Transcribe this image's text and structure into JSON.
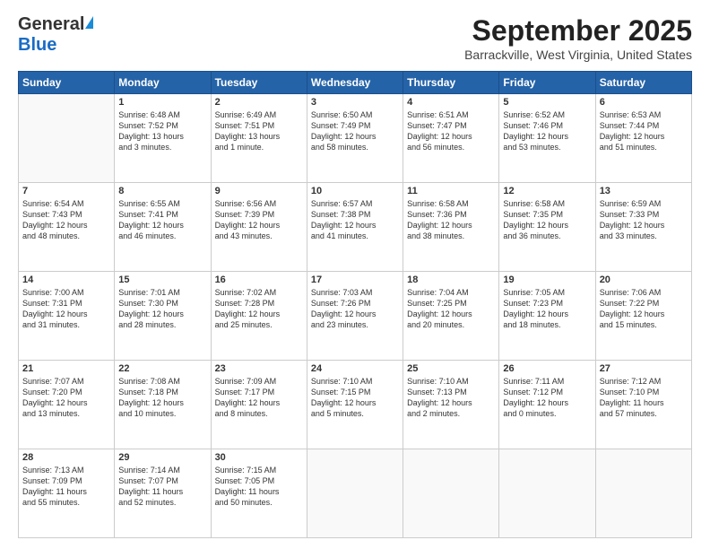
{
  "header": {
    "logo_general": "General",
    "logo_blue": "Blue",
    "month_title": "September 2025",
    "location": "Barrackville, West Virginia, United States"
  },
  "weekdays": [
    "Sunday",
    "Monday",
    "Tuesday",
    "Wednesday",
    "Thursday",
    "Friday",
    "Saturday"
  ],
  "weeks": [
    [
      {
        "day": "",
        "info": ""
      },
      {
        "day": "1",
        "info": "Sunrise: 6:48 AM\nSunset: 7:52 PM\nDaylight: 13 hours\nand 3 minutes."
      },
      {
        "day": "2",
        "info": "Sunrise: 6:49 AM\nSunset: 7:51 PM\nDaylight: 13 hours\nand 1 minute."
      },
      {
        "day": "3",
        "info": "Sunrise: 6:50 AM\nSunset: 7:49 PM\nDaylight: 12 hours\nand 58 minutes."
      },
      {
        "day": "4",
        "info": "Sunrise: 6:51 AM\nSunset: 7:47 PM\nDaylight: 12 hours\nand 56 minutes."
      },
      {
        "day": "5",
        "info": "Sunrise: 6:52 AM\nSunset: 7:46 PM\nDaylight: 12 hours\nand 53 minutes."
      },
      {
        "day": "6",
        "info": "Sunrise: 6:53 AM\nSunset: 7:44 PM\nDaylight: 12 hours\nand 51 minutes."
      }
    ],
    [
      {
        "day": "7",
        "info": "Sunrise: 6:54 AM\nSunset: 7:43 PM\nDaylight: 12 hours\nand 48 minutes."
      },
      {
        "day": "8",
        "info": "Sunrise: 6:55 AM\nSunset: 7:41 PM\nDaylight: 12 hours\nand 46 minutes."
      },
      {
        "day": "9",
        "info": "Sunrise: 6:56 AM\nSunset: 7:39 PM\nDaylight: 12 hours\nand 43 minutes."
      },
      {
        "day": "10",
        "info": "Sunrise: 6:57 AM\nSunset: 7:38 PM\nDaylight: 12 hours\nand 41 minutes."
      },
      {
        "day": "11",
        "info": "Sunrise: 6:58 AM\nSunset: 7:36 PM\nDaylight: 12 hours\nand 38 minutes."
      },
      {
        "day": "12",
        "info": "Sunrise: 6:58 AM\nSunset: 7:35 PM\nDaylight: 12 hours\nand 36 minutes."
      },
      {
        "day": "13",
        "info": "Sunrise: 6:59 AM\nSunset: 7:33 PM\nDaylight: 12 hours\nand 33 minutes."
      }
    ],
    [
      {
        "day": "14",
        "info": "Sunrise: 7:00 AM\nSunset: 7:31 PM\nDaylight: 12 hours\nand 31 minutes."
      },
      {
        "day": "15",
        "info": "Sunrise: 7:01 AM\nSunset: 7:30 PM\nDaylight: 12 hours\nand 28 minutes."
      },
      {
        "day": "16",
        "info": "Sunrise: 7:02 AM\nSunset: 7:28 PM\nDaylight: 12 hours\nand 25 minutes."
      },
      {
        "day": "17",
        "info": "Sunrise: 7:03 AM\nSunset: 7:26 PM\nDaylight: 12 hours\nand 23 minutes."
      },
      {
        "day": "18",
        "info": "Sunrise: 7:04 AM\nSunset: 7:25 PM\nDaylight: 12 hours\nand 20 minutes."
      },
      {
        "day": "19",
        "info": "Sunrise: 7:05 AM\nSunset: 7:23 PM\nDaylight: 12 hours\nand 18 minutes."
      },
      {
        "day": "20",
        "info": "Sunrise: 7:06 AM\nSunset: 7:22 PM\nDaylight: 12 hours\nand 15 minutes."
      }
    ],
    [
      {
        "day": "21",
        "info": "Sunrise: 7:07 AM\nSunset: 7:20 PM\nDaylight: 12 hours\nand 13 minutes."
      },
      {
        "day": "22",
        "info": "Sunrise: 7:08 AM\nSunset: 7:18 PM\nDaylight: 12 hours\nand 10 minutes."
      },
      {
        "day": "23",
        "info": "Sunrise: 7:09 AM\nSunset: 7:17 PM\nDaylight: 12 hours\nand 8 minutes."
      },
      {
        "day": "24",
        "info": "Sunrise: 7:10 AM\nSunset: 7:15 PM\nDaylight: 12 hours\nand 5 minutes."
      },
      {
        "day": "25",
        "info": "Sunrise: 7:10 AM\nSunset: 7:13 PM\nDaylight: 12 hours\nand 2 minutes."
      },
      {
        "day": "26",
        "info": "Sunrise: 7:11 AM\nSunset: 7:12 PM\nDaylight: 12 hours\nand 0 minutes."
      },
      {
        "day": "27",
        "info": "Sunrise: 7:12 AM\nSunset: 7:10 PM\nDaylight: 11 hours\nand 57 minutes."
      }
    ],
    [
      {
        "day": "28",
        "info": "Sunrise: 7:13 AM\nSunset: 7:09 PM\nDaylight: 11 hours\nand 55 minutes."
      },
      {
        "day": "29",
        "info": "Sunrise: 7:14 AM\nSunset: 7:07 PM\nDaylight: 11 hours\nand 52 minutes."
      },
      {
        "day": "30",
        "info": "Sunrise: 7:15 AM\nSunset: 7:05 PM\nDaylight: 11 hours\nand 50 minutes."
      },
      {
        "day": "",
        "info": ""
      },
      {
        "day": "",
        "info": ""
      },
      {
        "day": "",
        "info": ""
      },
      {
        "day": "",
        "info": ""
      }
    ]
  ]
}
